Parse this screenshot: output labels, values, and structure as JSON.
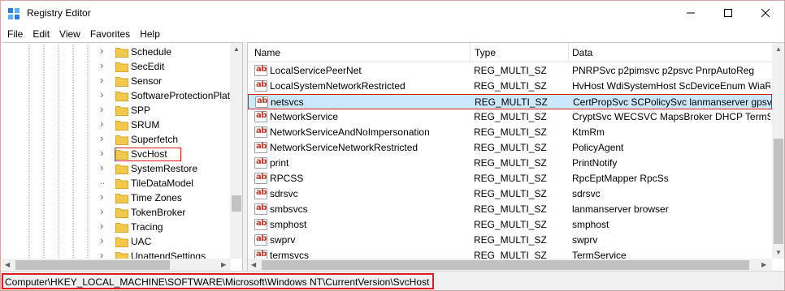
{
  "window": {
    "title": "Registry Editor",
    "controls": {
      "minimize": "—",
      "maximize": "☐",
      "close": "✕"
    }
  },
  "menu": [
    "File",
    "Edit",
    "View",
    "Favorites",
    "Help"
  ],
  "tree": {
    "items": [
      {
        "label": "Schedule",
        "expandable": true
      },
      {
        "label": "SecEdit",
        "expandable": true
      },
      {
        "label": "Sensor",
        "expandable": true
      },
      {
        "label": "SoftwareProtectionPlat",
        "expandable": true
      },
      {
        "label": "SPP",
        "expandable": true
      },
      {
        "label": "SRUM",
        "expandable": true
      },
      {
        "label": "Superfetch",
        "expandable": true
      },
      {
        "label": "SvcHost",
        "expandable": true,
        "selected": true
      },
      {
        "label": "SystemRestore",
        "expandable": true
      },
      {
        "label": "TileDataModel",
        "expandable": false
      },
      {
        "label": "Time Zones",
        "expandable": true
      },
      {
        "label": "TokenBroker",
        "expandable": true
      },
      {
        "label": "Tracing",
        "expandable": true
      },
      {
        "label": "UAC",
        "expandable": true
      },
      {
        "label": "UnattendSettings",
        "expandable": true
      }
    ]
  },
  "list": {
    "columns": {
      "name": "Name",
      "type": "Type",
      "data": "Data"
    },
    "rows": [
      {
        "name": "LocalServicePeerNet",
        "type": "REG_MULTI_SZ",
        "data": "PNRPSvc p2pimsvc p2psvc PnrpAutoReg"
      },
      {
        "name": "LocalSystemNetworkRestricted",
        "type": "REG_MULTI_SZ",
        "data": "HvHost WdiSystemHost ScDeviceEnum WiaRp"
      },
      {
        "name": "netsvcs",
        "type": "REG_MULTI_SZ",
        "data": "CertPropSvc SCPolicySvc lanmanserver gpsvc",
        "selected": true
      },
      {
        "name": "NetworkService",
        "type": "REG_MULTI_SZ",
        "data": "CryptSvc WECSVC MapsBroker DHCP TermSer"
      },
      {
        "name": "NetworkServiceAndNoImpersonation",
        "type": "REG_MULTI_SZ",
        "data": "KtmRm"
      },
      {
        "name": "NetworkServiceNetworkRestricted",
        "type": "REG_MULTI_SZ",
        "data": "PolicyAgent"
      },
      {
        "name": "print",
        "type": "REG_MULTI_SZ",
        "data": "PrintNotify"
      },
      {
        "name": "RPCSS",
        "type": "REG_MULTI_SZ",
        "data": "RpcEptMapper RpcSs"
      },
      {
        "name": "sdrsvc",
        "type": "REG_MULTI_SZ",
        "data": "sdrsvc"
      },
      {
        "name": "smbsvcs",
        "type": "REG_MULTI_SZ",
        "data": "lanmanserver browser"
      },
      {
        "name": "smphost",
        "type": "REG_MULTI_SZ",
        "data": "smphost"
      },
      {
        "name": "swprv",
        "type": "REG_MULTI_SZ",
        "data": "swprv"
      },
      {
        "name": "termsvcs",
        "type": "REG_MULTI_SZ",
        "data": "TermService"
      }
    ]
  },
  "status": {
    "path": "Computer\\HKEY_LOCAL_MACHINE\\SOFTWARE\\Microsoft\\Windows NT\\CurrentVersion\\SvcHost"
  },
  "colors": {
    "highlight": "#e01b24",
    "selection": "#cce8ff",
    "folder": "#f2c94c"
  }
}
